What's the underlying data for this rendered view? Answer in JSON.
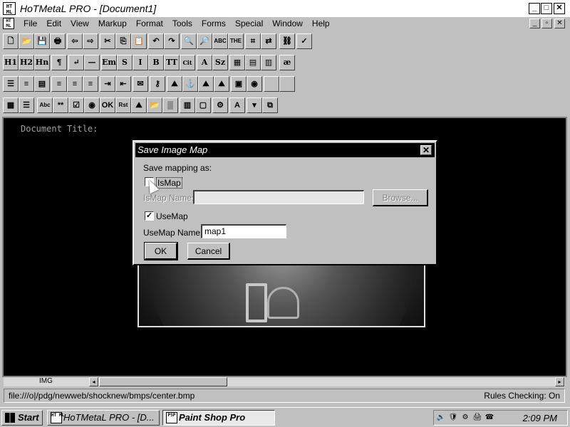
{
  "window": {
    "title": "HoTMetaL PRO - [Document1]",
    "icon_text": "HT ML",
    "controls": [
      "_",
      "□",
      "✕"
    ],
    "mdi_controls": [
      "_",
      "▫",
      "✕"
    ]
  },
  "menu": {
    "items": [
      "File",
      "Edit",
      "View",
      "Markup",
      "Format",
      "Tools",
      "Forms",
      "Special",
      "Window",
      "Help"
    ]
  },
  "toolbars": {
    "row1": [
      {
        "name": "new-doc-icon",
        "glyph": "🗋"
      },
      {
        "name": "open-folder-icon",
        "glyph": "📂"
      },
      {
        "name": "save-icon",
        "glyph": "💾"
      },
      {
        "name": "print-icon",
        "glyph": "🖶"
      },
      {
        "name": "back-icon",
        "glyph": "⇦"
      },
      {
        "name": "forward-icon",
        "glyph": "⇨"
      },
      {
        "name": "cut-icon",
        "glyph": "✂"
      },
      {
        "name": "copy-icon",
        "glyph": "⎘"
      },
      {
        "name": "paste-icon",
        "glyph": "📋"
      },
      {
        "name": "undo-icon",
        "glyph": "↶"
      },
      {
        "name": "redo-icon",
        "glyph": "↷"
      },
      {
        "name": "find-icon",
        "glyph": "🔍"
      },
      {
        "name": "find-replace-icon",
        "glyph": "🔎"
      },
      {
        "name": "spell-check-icon",
        "glyph": "ABC"
      },
      {
        "name": "thesaurus-icon",
        "glyph": "THE"
      },
      {
        "name": "tag-icon",
        "glyph": "⌗"
      },
      {
        "name": "tag-replace-icon",
        "glyph": "⇄"
      },
      {
        "name": "link-icon",
        "glyph": "⛓"
      },
      {
        "name": "sgml-validate-icon",
        "glyph": "✓"
      }
    ],
    "row2": [
      {
        "name": "h1-icon",
        "glyph": "H1"
      },
      {
        "name": "h2-icon",
        "glyph": "H2"
      },
      {
        "name": "hn-icon",
        "glyph": "Hn"
      },
      {
        "name": "paragraph-icon",
        "glyph": "¶"
      },
      {
        "name": "line-break-icon",
        "glyph": "↵"
      },
      {
        "name": "horizontal-rule-icon",
        "glyph": "—"
      },
      {
        "name": "emphasis-icon",
        "glyph": "Em"
      },
      {
        "name": "strong-icon",
        "glyph": "S"
      },
      {
        "name": "italic-icon",
        "glyph": "I"
      },
      {
        "name": "bold-icon",
        "glyph": "B"
      },
      {
        "name": "teletype-icon",
        "glyph": "TT"
      },
      {
        "name": "cite-icon",
        "glyph": "Cit"
      },
      {
        "name": "font-size-icon",
        "glyph": "A"
      },
      {
        "name": "font-size-dropdown-icon",
        "glyph": "Sz"
      },
      {
        "name": "table-icon",
        "glyph": "▦"
      },
      {
        "name": "table-row-icon",
        "glyph": "▤"
      },
      {
        "name": "table-cell-icon",
        "glyph": "▥"
      },
      {
        "name": "special-char-icon",
        "glyph": "æ"
      }
    ],
    "row3": [
      {
        "name": "bullet-list-icon",
        "glyph": "☰"
      },
      {
        "name": "numbered-list-icon",
        "glyph": "≡"
      },
      {
        "name": "definition-list-icon",
        "glyph": "▤"
      },
      {
        "name": "align-left-icon",
        "glyph": "≡"
      },
      {
        "name": "align-center-icon",
        "glyph": "≡"
      },
      {
        "name": "align-right-icon",
        "glyph": "≡"
      },
      {
        "name": "indent-icon",
        "glyph": "⇥"
      },
      {
        "name": "outdent-icon",
        "glyph": "⇤"
      },
      {
        "name": "comment-icon",
        "glyph": "✉"
      },
      {
        "name": "key-icon",
        "glyph": "⚷"
      },
      {
        "name": "image-icon",
        "glyph": "⛰"
      },
      {
        "name": "anchor-icon",
        "glyph": "⚓"
      },
      {
        "name": "image-map-icon",
        "glyph": "⛰"
      },
      {
        "name": "image-link-icon",
        "glyph": "⛰"
      },
      {
        "name": "background-image-icon",
        "glyph": "▣"
      },
      {
        "name": "sound-icon",
        "glyph": "◉"
      },
      {
        "name": "blank-icon",
        "glyph": ""
      },
      {
        "name": "blank-icon-2",
        "glyph": ""
      }
    ],
    "row4": [
      {
        "name": "form-icon",
        "glyph": "▦"
      },
      {
        "name": "form-list-icon",
        "glyph": "☰"
      },
      {
        "name": "text-field-icon",
        "glyph": "Abc"
      },
      {
        "name": "password-field-icon",
        "glyph": "**"
      },
      {
        "name": "checkbox-field-icon",
        "glyph": "☑"
      },
      {
        "name": "radio-field-icon",
        "glyph": "◉"
      },
      {
        "name": "submit-button-icon",
        "glyph": "OK"
      },
      {
        "name": "reset-button-icon",
        "glyph": "Rst"
      },
      {
        "name": "image-field-icon",
        "glyph": "⛰"
      },
      {
        "name": "file-field-icon",
        "glyph": "📂"
      },
      {
        "name": "hidden-field-icon",
        "glyph": "▒"
      },
      {
        "name": "frame-icon",
        "glyph": "▥"
      },
      {
        "name": "frameset-icon",
        "glyph": "▢"
      },
      {
        "name": "plugin-icon",
        "glyph": "⚙"
      },
      {
        "name": "font-icon",
        "glyph": "A"
      },
      {
        "name": "select-icon",
        "glyph": "▾"
      },
      {
        "name": "object-icon",
        "glyph": "⧉"
      }
    ]
  },
  "editor": {
    "document_title_label": "Document Title:"
  },
  "dialog": {
    "title": "Save Image Map",
    "close": "✕",
    "save_mapping_label": "Save mapping as:",
    "ismap_label": "IsMap",
    "ismap_checked": false,
    "ismap_name_label": "IsMap Name:",
    "ismap_name_value": "",
    "browse_label": "Browse...",
    "usemap_label": "UseMap",
    "usemap_checked": true,
    "usemap_check_glyph": "✓",
    "usemap_name_label": "UseMap Name:",
    "usemap_name_value": "map1",
    "ok_label": "OK",
    "cancel_label": "Cancel"
  },
  "scrollbar": {
    "tag_label": "IMG",
    "left_arrow": "◂",
    "right_arrow": "▸"
  },
  "status": {
    "path": "file:///o|/pdg/newweb/shocknew/bmps/center.bmp",
    "rules": "Rules Checking: On"
  },
  "taskbar": {
    "start_label": "Start",
    "tasks": [
      {
        "label": "HoTMetaL PRO - [D...",
        "icon": "HT ML",
        "active": false
      },
      {
        "label": "Paint Shop Pro",
        "icon": "PSP",
        "active": true
      }
    ],
    "tray_icons": [
      "🔊",
      "🛡",
      "⚙",
      "🖨",
      "☎"
    ],
    "clock": "2:09 PM"
  }
}
